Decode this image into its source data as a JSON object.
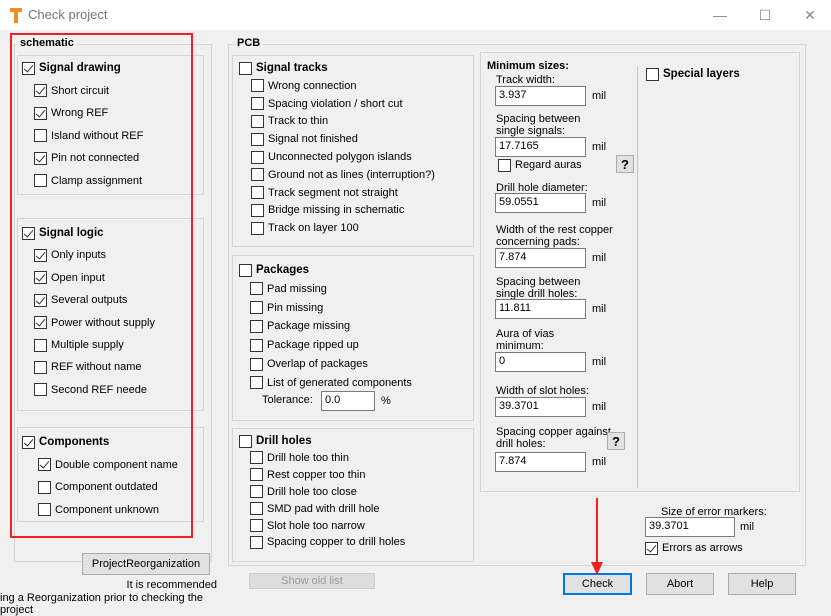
{
  "window": {
    "title": "Check project",
    "minimize": "—",
    "maximize": "☐",
    "close": "✕"
  },
  "colors": {
    "highlight": "#ee2222",
    "accent": "#0078d7",
    "logo": "#f08c1e"
  },
  "schematic": {
    "title": "schematic",
    "signal_drawing": {
      "label": "Signal drawing",
      "checked": true,
      "items": [
        {
          "label": "Short circuit",
          "checked": true
        },
        {
          "label": "Wrong REF",
          "checked": true
        },
        {
          "label": "Island without REF",
          "checked": false
        },
        {
          "label": "Pin not connected",
          "checked": true
        },
        {
          "label": "Clamp assignment",
          "checked": false
        }
      ]
    },
    "signal_logic": {
      "label": "Signal logic",
      "checked": true,
      "items": [
        {
          "label": "Only inputs",
          "checked": true
        },
        {
          "label": "Open input",
          "checked": true
        },
        {
          "label": "Several outputs",
          "checked": true
        },
        {
          "label": "Power without supply",
          "checked": true
        },
        {
          "label": "Multiple supply",
          "checked": false
        },
        {
          "label": "REF without name",
          "checked": false
        },
        {
          "label": "Second REF neede",
          "checked": false
        }
      ]
    },
    "components": {
      "label": "Components",
      "checked": true,
      "items": [
        {
          "label": "Double component name",
          "checked": true
        },
        {
          "label": "Component outdated",
          "checked": false
        },
        {
          "label": "Component unknown",
          "checked": false
        }
      ]
    },
    "reorg_button": "ProjectReorganization",
    "note1": "It is recommended",
    "note2": "ing a Reorganization prior to checking the project"
  },
  "pcb": {
    "title": "PCB",
    "signal_tracks": {
      "label": "Signal tracks",
      "checked": false,
      "items": [
        {
          "label": "Wrong connection",
          "checked": false
        },
        {
          "label": "Spacing violation / short cut",
          "checked": false
        },
        {
          "label": "Track to thin",
          "checked": false
        },
        {
          "label": "Signal not finished",
          "checked": false
        },
        {
          "label": "Unconnected polygon islands",
          "checked": false
        },
        {
          "label": "Ground not as lines (interruption?)",
          "checked": false
        },
        {
          "label": "Track segment not straight",
          "checked": false
        },
        {
          "label": "Bridge missing in schematic",
          "checked": false
        },
        {
          "label": "Track on layer 100",
          "checked": false
        }
      ]
    },
    "packages": {
      "label": "Packages",
      "checked": false,
      "items": [
        {
          "label": "Pad missing",
          "checked": false
        },
        {
          "label": "Pin missing",
          "checked": false
        },
        {
          "label": "Package missing",
          "checked": false
        },
        {
          "label": "Package ripped up",
          "checked": false
        },
        {
          "label": "Overlap of packages",
          "checked": false
        },
        {
          "label": "List of generated components",
          "checked": false
        }
      ],
      "tolerance_label": "Tolerance:",
      "tolerance_value": "0.0",
      "tolerance_unit": "%"
    },
    "drill_holes": {
      "label": "Drill holes",
      "checked": false,
      "items": [
        {
          "label": "Drill hole too thin",
          "checked": false
        },
        {
          "label": "Rest copper too thin",
          "checked": false
        },
        {
          "label": "Drill hole too close",
          "checked": false
        },
        {
          "label": "SMD pad with drill hole",
          "checked": false
        },
        {
          "label": "Slot hole too narrow",
          "checked": false
        },
        {
          "label": "Spacing copper to drill holes",
          "checked": false
        }
      ]
    },
    "min_sizes": {
      "title": "Minimum sizes:",
      "unit": "mil",
      "track_width": {
        "label": "Track width:",
        "value": "3.937"
      },
      "spacing_signals": {
        "label1": "Spacing between",
        "label2": "single signals:",
        "value": "17.7165"
      },
      "regard_auras": {
        "label": "Regard auras",
        "checked": false
      },
      "drill_diameter": {
        "label": "Drill hole diameter:",
        "value": "59.0551"
      },
      "rest_copper": {
        "label1": "Width of the rest copper",
        "label2": "concerning pads:",
        "value": "7.874"
      },
      "spacing_drill": {
        "label1": "Spacing between",
        "label2": "single drill holes:",
        "value": "11.811"
      },
      "aura_vias": {
        "label1": "Aura of vias",
        "label2": "minimum:",
        "value": "0"
      },
      "slot_holes": {
        "label": "Width of slot holes:",
        "value": "39.3701"
      },
      "copper_drill": {
        "label1": "Spacing copper against",
        "label2": "drill holes:",
        "value": "7.874"
      },
      "help": "?"
    },
    "special_layers": {
      "label": "Special layers",
      "checked": false
    },
    "error_markers": {
      "label": "Size of error markers:",
      "value": "39.3701",
      "unit": "mil"
    },
    "errors_as_arrows": {
      "label": "Errors as arrows",
      "checked": true
    }
  },
  "buttons": {
    "show_old": "Show old list",
    "check": "Check",
    "abort": "Abort",
    "help": "Help"
  }
}
